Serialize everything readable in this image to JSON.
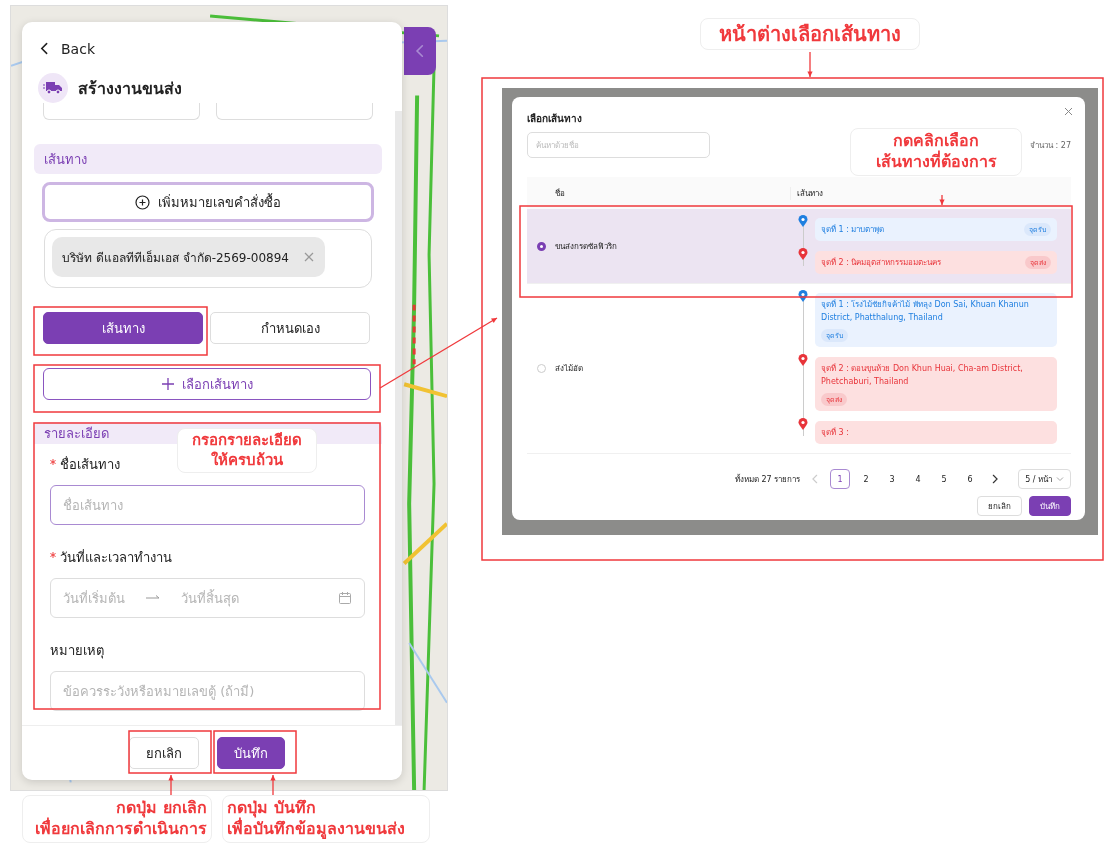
{
  "panel": {
    "back": "Back",
    "title": "สร้างงานขนส่ง",
    "route_section": "เส้นทาง",
    "add_po_button": "เพิ่มหมายเลขคำสั่งซื้อ",
    "po_tags": [
      {
        "label": "บริษัท ดีแอลทีทีเอ็มเอส จำกัด-2569-00894"
      }
    ],
    "mode_tabs": [
      {
        "label": "เส้นทาง",
        "selected": true
      },
      {
        "label": "กำหนดเอง",
        "selected": false
      }
    ],
    "choose_route_button": "เลือกเส้นทาง",
    "details_section": "รายละเอียด",
    "fields": [
      {
        "kind": "text",
        "label": "ชื่อเส้นทาง",
        "required": true,
        "focused": true,
        "placeholder": "ชื่อเส้นทาง"
      },
      {
        "kind": "daterange",
        "label": "วันที่และเวลาทำงาน",
        "required": true,
        "focused": false,
        "placeholder": "วันที่เริ่มต้น",
        "placeholder_end": "วันที่สิ้นสุด"
      },
      {
        "kind": "text",
        "label": "หมายเหตุ",
        "required": false,
        "focused": false,
        "placeholder": "ข้อควรระวังหรือหมายเลขตู้ (ถ้ามี)"
      }
    ],
    "cancel_button": "ยกเลิก",
    "save_button": "บันทึก"
  },
  "modal": {
    "title": "เลือกเส้นทาง",
    "search": {
      "placeholder": "ค้นหาด้วยชื่อ"
    },
    "count": "จำนวน : 27",
    "columns": [
      "ชื่อ",
      "เส้นทาง"
    ],
    "rows": [
      {
        "name": "ขนส่งกรดซัลฟิวริก",
        "selected": true,
        "stops": [
          {
            "kind": "pickup",
            "label": "จุดที่ 1 : มาบตาพุด",
            "tag": "จุดรับ"
          },
          {
            "kind": "dropoff",
            "label": "จุดที่ 2 : นิคมอุตสาหกรรมอมตะนคร",
            "tag": "จุดส่ง"
          }
        ]
      },
      {
        "name": "ส่งไม้อัด",
        "selected": false,
        "stops": [
          {
            "kind": "pickup",
            "label": "จุดที่ 1 : โรงไม้ชัยกิจค้าไม้ พัทลุง Don Sai, Khuan Khanun District, Phatthalung, Thailand",
            "tag": "จุดรับ"
          },
          {
            "kind": "dropoff",
            "label": "จุดที่ 2 : ดอนขุนห้วย Don Khun Huai, Cha-am District, Phetchaburi, Thailand",
            "tag": "จุดส่ง"
          },
          {
            "kind": "dropoff",
            "label": "จุดที่ 3 :"
          }
        ]
      }
    ],
    "pagination": {
      "total": "ทั้งหมด 27 รายการ",
      "prev_disabled": true,
      "pages": [
        {
          "label": "1",
          "selected": true
        },
        {
          "label": "2",
          "selected": false
        },
        {
          "label": "3",
          "selected": false
        },
        {
          "label": "4",
          "selected": false
        },
        {
          "label": "5",
          "selected": false
        },
        {
          "label": "6",
          "selected": false
        }
      ],
      "page_size": "5 / หน้า"
    },
    "cancel_button": "ยกเลิก",
    "save_button": "บันทึก"
  },
  "annotations": [
    {
      "lines": [
        "หน้าต่างเลือกเส้นทาง"
      ]
    },
    {
      "lines": [
        "กดคลิกเลือก",
        "เส้นทางที่ต้องการ"
      ]
    },
    {
      "lines": [
        "กรอกรายละเอียด",
        "ให้ครบถ้วน"
      ]
    },
    {
      "lines": [
        "กดปุ่ม ยกเลิก",
        "เพื่อยกเลิกการดำเนินการ"
      ]
    },
    {
      "lines": [
        "กดปุ่ม บันทึก",
        "เพื่อบันทึกข้อมูลงานขนส่ง"
      ]
    }
  ]
}
